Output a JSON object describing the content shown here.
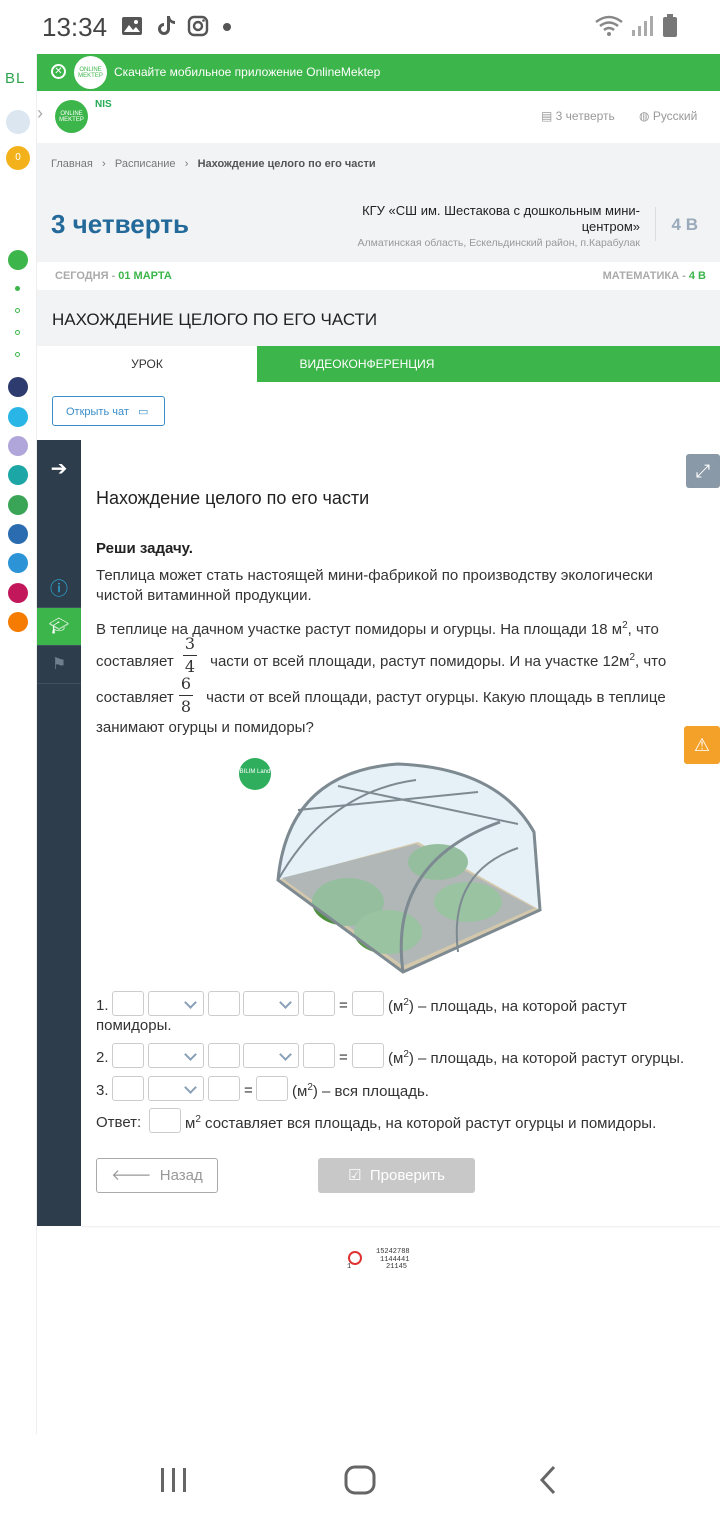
{
  "status": {
    "time": "13:34"
  },
  "rail": {
    "logo_text": "BL",
    "badge_count": "0"
  },
  "banner": {
    "text": "Скачайте мобильное приложение OnlineMektep",
    "logo_text": "ONLINE MEKTEP"
  },
  "header": {
    "logo_text": "ONLINE MEKTEP",
    "nis_text": "NIS",
    "quarter_label": "3 четверть",
    "language": "Русский"
  },
  "breadcrumb": {
    "home": "Главная",
    "schedule": "Расписание",
    "current": "Нахождение целого по его части"
  },
  "page": {
    "quarter_title": "3 четверть",
    "school_name": "КГУ «СШ им. Шестакова с дошкольным мини-центром»",
    "school_address": "Алматинская область, Ескельдинский район, п.Карабулак",
    "grade": "4 В"
  },
  "day": {
    "today_label": "СЕГОДНЯ -",
    "date": "01 МАРТА",
    "subject_label": "МАТЕМАТИКА -",
    "subject_grade": "4 В"
  },
  "lesson": {
    "title": "НАХОЖДЕНИЕ ЦЕЛОГО ПО ЕГО ЧАСТИ"
  },
  "tabs": [
    {
      "label": "УРОК"
    },
    {
      "label": "ВИДЕОКОНФЕРЕНЦИЯ"
    }
  ],
  "chat": {
    "label": "Открыть чат"
  },
  "content": {
    "heading": "Нахождение целого по его части",
    "task_label": "Реши задачу.",
    "intro": "Теплица может стать настоящей мини-фабрикой по производству экологически чистой витаминной продукции.",
    "p1": "В теплице на дачном участке растут помидоры и огурцы. На площади 18 м",
    "p1b": ", что",
    "p2a": "составляет",
    "p2b": "части от всей площади, растут помидоры. И на участке 12м",
    "p2c": ", что",
    "p3a": "составляет",
    "p3b": "части от всей площади, растут огурцы. Какую площадь в теплице",
    "p4": "занимают огурцы и помидоры?",
    "sup2": "2",
    "frac1": {
      "num": "3",
      "den": "4"
    },
    "frac2": {
      "num": "6",
      "den": "8"
    },
    "image_badge": "BILIM Land"
  },
  "equations": {
    "row1_num": "1.",
    "row1_text": "(м",
    "row1_tail": ") – площадь, на которой растут",
    "row1_wrap": "помидоры.",
    "row2_num": "2.",
    "row2_text": "(м",
    "row2_tail": ") – площадь, на которой растут огурцы.",
    "row3_num": "3.",
    "row3_text": "(м",
    "row3_tail": ") – вся площадь.",
    "equals": "=",
    "answer_label": "Ответ:",
    "answer_unit": "м",
    "answer_tail": "составляет вся площадь, на которой растут огурцы и помидоры.",
    "sup2": "2"
  },
  "buttons": {
    "back": "Назад",
    "check": "Проверить"
  },
  "counter": {
    "line1": "15242788",
    "line2": "1144441",
    "line3": "21145",
    "left": "1"
  }
}
